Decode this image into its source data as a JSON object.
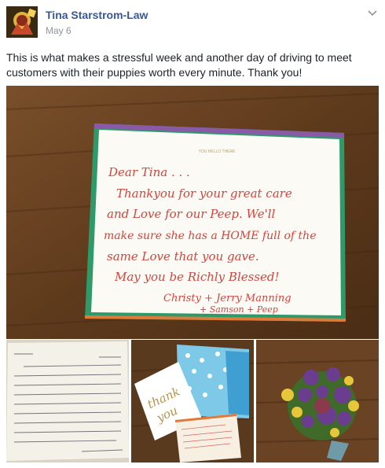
{
  "post": {
    "author": "Tina Starstrom-Law",
    "date": "May 6",
    "text": "This is what makes a stressful week and another day of driving to meet customers with their puppies worth every minute. Thank you!"
  },
  "card": {
    "header_line": "YOU HELLO THERE",
    "lines": [
      "Dear Tina . . .",
      "Thankyou for your great care",
      "and Love for our Peep. We'll",
      "make sure she has a HOME full of the",
      "same Love that you gave.",
      "May you be Richly Blessed!",
      "Christy + Jerry Manning",
      "+ Samson + Peep"
    ]
  },
  "thumb2_card": {
    "front_line1": "thank",
    "front_line2": "you"
  },
  "icons": {
    "menu": "chevron-down-icon",
    "avatar": "profile-picture"
  },
  "colors": {
    "author_link": "#365899",
    "meta_gray": "#90949c",
    "ink_red": "#d2453f",
    "wood": "#6b4423"
  }
}
